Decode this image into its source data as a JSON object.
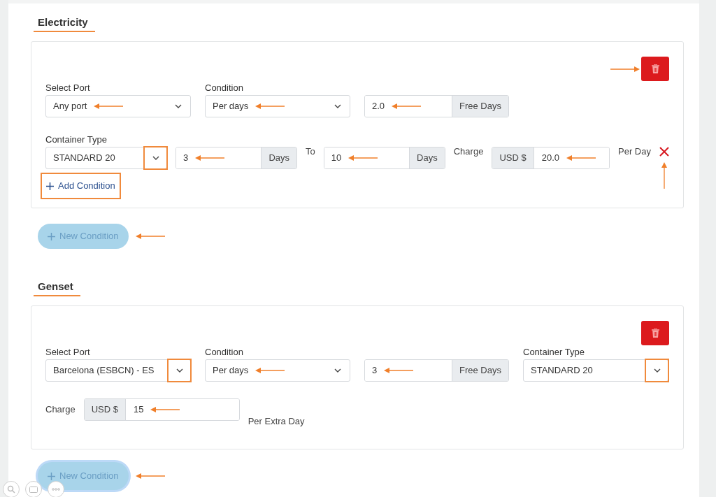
{
  "sections": [
    {
      "title": "Electricity",
      "delete_arrow": true,
      "rows": [
        {
          "items": [
            {
              "kind": "select",
              "label": "Select Port",
              "value": "Any port",
              "arrow": true,
              "highlighted": false
            },
            {
              "kind": "select",
              "label": "Condition",
              "value": "Per days",
              "arrow": true,
              "highlighted": false
            },
            {
              "kind": "suffix_input",
              "value": "2.0",
              "addon": "Free Days",
              "arrow": true
            }
          ]
        },
        {
          "items": [
            {
              "kind": "select",
              "label": "Container Type",
              "value": "STANDARD 20",
              "arrow": false,
              "highlighted": true
            },
            {
              "kind": "suffix_input",
              "value": "3",
              "addon": "Days",
              "arrow": true
            },
            {
              "kind": "text",
              "text": "To"
            },
            {
              "kind": "suffix_input",
              "value": "10",
              "addon": "Days",
              "arrow": true
            },
            {
              "kind": "text",
              "text": "Charge"
            },
            {
              "kind": "prefix_input",
              "addon": "USD $",
              "value": "20.0",
              "arrow": true
            },
            {
              "kind": "text",
              "text": "Per Day"
            },
            {
              "kind": "remove",
              "arrow": true
            }
          ]
        }
      ],
      "add_condition": {
        "label": "Add Condition",
        "highlighted": true
      },
      "new_condition": {
        "label": "New Condition",
        "arrow": true,
        "focused": false
      }
    },
    {
      "title": "Genset",
      "delete_arrow": false,
      "rows": [
        {
          "items": [
            {
              "kind": "select",
              "label": "Select Port",
              "value": "Barcelona (ESBCN) - ES",
              "arrow": false,
              "highlighted": true
            },
            {
              "kind": "select",
              "label": "Condition",
              "value": "Per days",
              "arrow": true,
              "highlighted": false
            },
            {
              "kind": "suffix_input",
              "value": "3",
              "addon": "Free Days",
              "arrow": true
            },
            {
              "kind": "select",
              "label": "Container Type",
              "value": "STANDARD 20",
              "arrow": false,
              "highlighted": true
            }
          ]
        },
        {
          "items": [
            {
              "kind": "text",
              "text": "Charge"
            },
            {
              "kind": "prefix_input",
              "addon": "USD $",
              "value": "15",
              "arrow": true,
              "wide": true
            },
            {
              "kind": "text",
              "text": "Per Extra Day",
              "low": true
            }
          ]
        }
      ],
      "new_condition": {
        "label": "New Condition",
        "arrow": true,
        "focused": true
      }
    }
  ]
}
